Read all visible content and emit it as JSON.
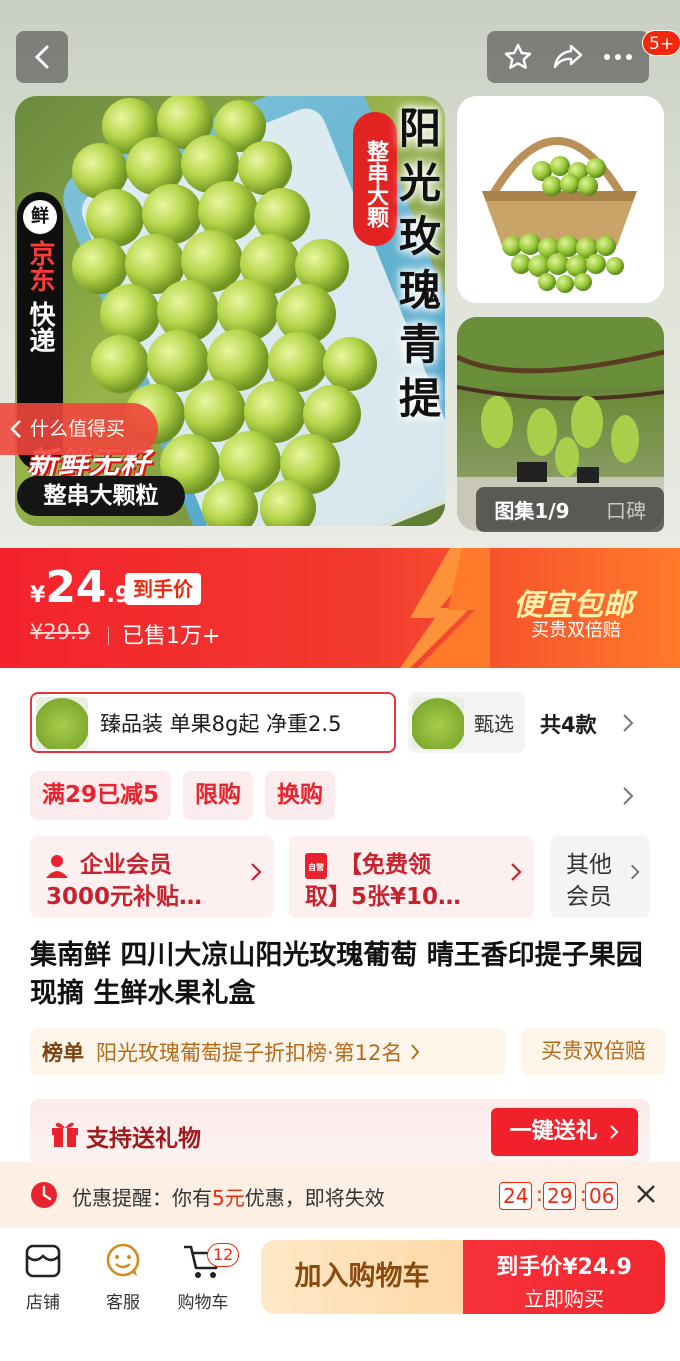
{
  "header": {
    "cart_badge": "5+"
  },
  "gallery": {
    "main_title_bubble": "整串大颗",
    "main_title": "阳光玫瑰青提",
    "jd_seal": "鲜",
    "jd_line1": "京东",
    "jd_line2": "快递",
    "fresh_text": "新鲜无籽",
    "big_grain_pill": "整串大颗粒",
    "worth_tag": "什么值得买",
    "album_label": "图集1/9",
    "reviews_label": "口碑"
  },
  "price": {
    "currency": "¥",
    "integer": "24",
    "decimal": ".9",
    "tag": "到手价",
    "original": "¥29.9",
    "sold": "已售1万+",
    "promo_title": "便宜包邮",
    "promo_sub": "买贵双倍赔"
  },
  "sku": {
    "selected_label": "臻品装 单果8g起 净重2.5",
    "alt_label": "甄选",
    "count": "共4款"
  },
  "promo_tags": [
    "满29已减5",
    "限购",
    "换购"
  ],
  "members": {
    "card1_line1": "企业会员",
    "card1_line2": "3000元补贴…",
    "card2_line1": "【免费领",
    "card2_line2": "取】5张¥10…",
    "card2_icon_text": "自营",
    "card3_line1": "其他",
    "card3_line2": "会员"
  },
  "product": {
    "title": "集南鲜 四川大凉山阳光玫瑰葡萄 晴王香印提子果园现摘 生鲜水果礼盒"
  },
  "rank": {
    "key": "榜单",
    "value": "阳光玫瑰葡萄提子折扣榜·第12名",
    "guarantee": "买贵双倍赔"
  },
  "gift": {
    "label": "支持送礼物",
    "button": "一键送礼"
  },
  "reminder": {
    "prefix": "优惠提醒：你有",
    "amount": "5元",
    "suffix": "优惠，即将失效",
    "hours": "24",
    "minutes": "29",
    "seconds": "06"
  },
  "bottom": {
    "shop_label": "店铺",
    "service_label": "客服",
    "cart_label": "购物车",
    "cart_count": "12",
    "add_cart": "加入购物车",
    "buy_line1": "到手价¥24.9",
    "buy_line2": "立即购买"
  },
  "colors": {
    "brand_red": "#f2270c",
    "promo_orange": "#ff7a2a",
    "cart_button": "#ffd9a9"
  }
}
